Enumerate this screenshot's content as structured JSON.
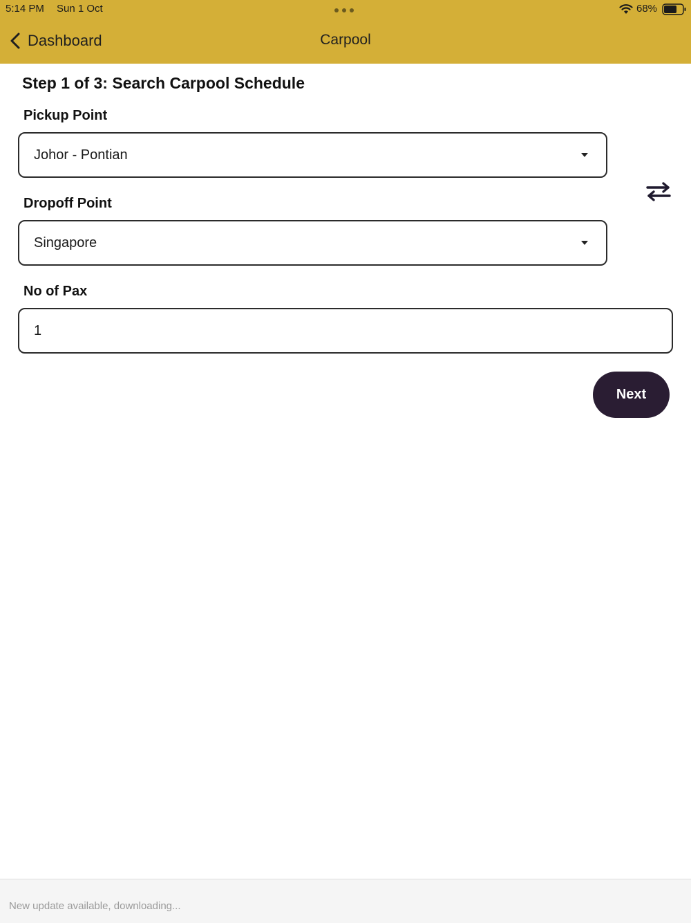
{
  "status_bar": {
    "time": "5:14 PM",
    "date": "Sun 1 Oct",
    "battery": "68%",
    "icons": [
      "wifi-icon",
      "battery-icon"
    ]
  },
  "nav": {
    "back_label": "Dashboard",
    "title": "Carpool",
    "back_icon": "chevron-left-icon"
  },
  "form": {
    "step_title": "Step 1 of 3: Search Carpool Schedule",
    "pickup": {
      "label": "Pickup Point",
      "value": "Johor - Pontian"
    },
    "dropoff": {
      "label": "Dropoff Point",
      "value": "Singapore"
    },
    "pax": {
      "label": "No of Pax",
      "value": "1"
    },
    "swap_icon": "swap-arrows-icon",
    "next_label": "Next"
  },
  "footer": {
    "update_text": "New update available, downloading..."
  },
  "colors": {
    "header_bg": "#d4af37",
    "button_bg": "#2a1d33",
    "button_text": "#ffffff"
  }
}
